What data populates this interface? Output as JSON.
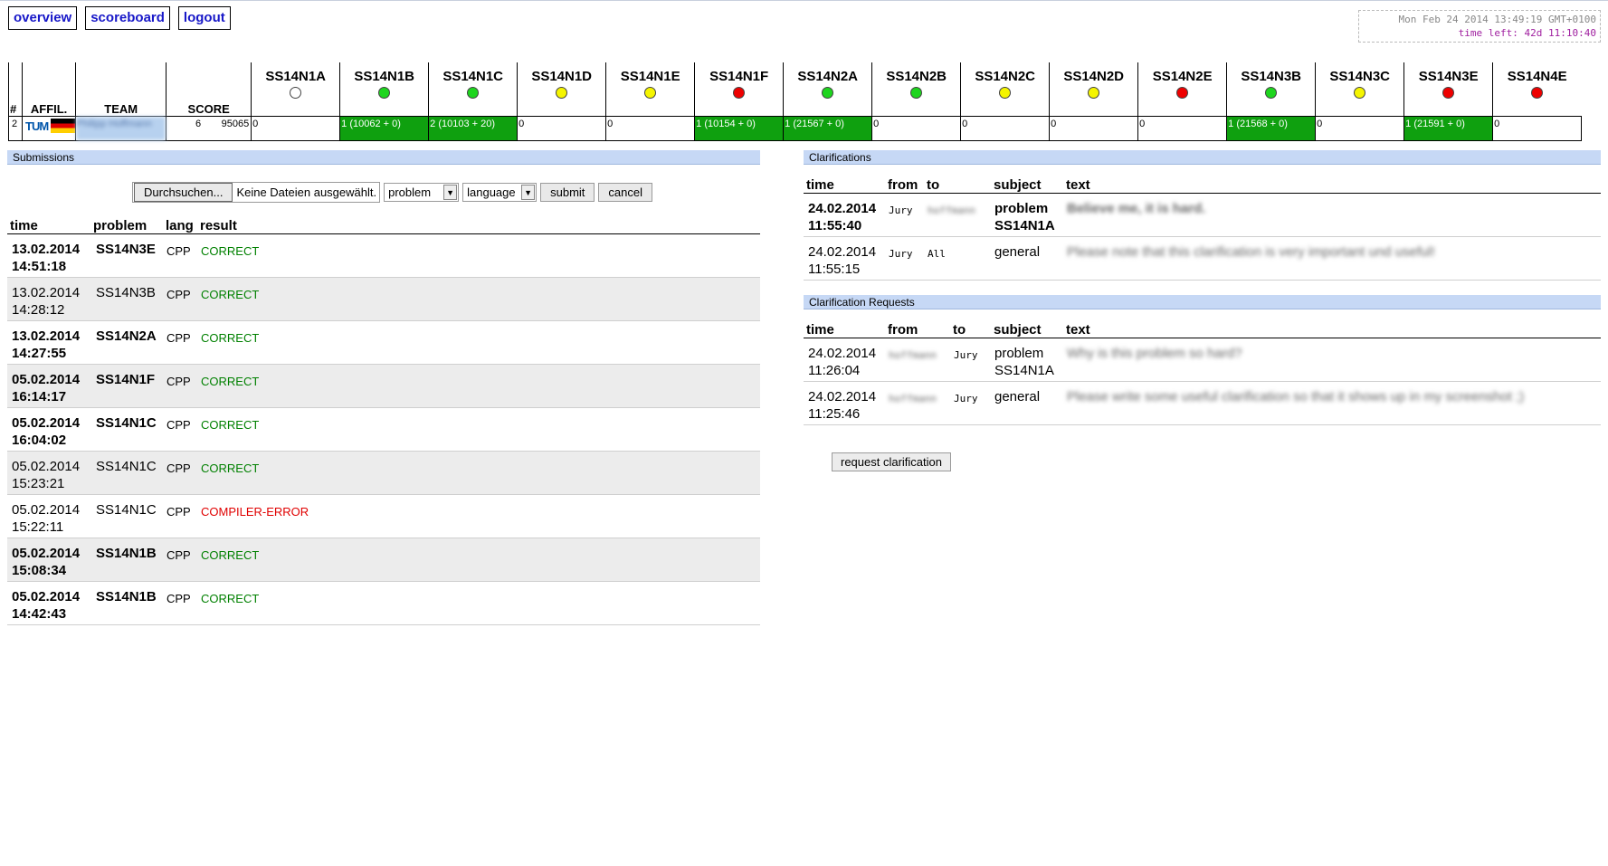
{
  "nav": {
    "overview": "overview",
    "scoreboard": "scoreboard",
    "logout": "logout"
  },
  "clock": {
    "time": "Mon Feb 24 2014 13:49:19 GMT+0100",
    "left": "time left: 42d 11:10:40"
  },
  "scoreboard": {
    "headers": {
      "rank": "#",
      "affil": "AFFIL.",
      "team": "TEAM",
      "score": "SCORE"
    },
    "problems": [
      {
        "name": "SS14N1A",
        "color": "#ffffff"
      },
      {
        "name": "SS14N1B",
        "color": "#1ed51e"
      },
      {
        "name": "SS14N1C",
        "color": "#1ed51e"
      },
      {
        "name": "SS14N1D",
        "color": "#f5f500"
      },
      {
        "name": "SS14N1E",
        "color": "#f5f500"
      },
      {
        "name": "SS14N1F",
        "color": "#ee0000"
      },
      {
        "name": "SS14N2A",
        "color": "#1ed51e"
      },
      {
        "name": "SS14N2B",
        "color": "#1ed51e"
      },
      {
        "name": "SS14N2C",
        "color": "#f5f500"
      },
      {
        "name": "SS14N2D",
        "color": "#f5f500"
      },
      {
        "name": "SS14N2E",
        "color": "#ee0000"
      },
      {
        "name": "SS14N3B",
        "color": "#1ed51e"
      },
      {
        "name": "SS14N3C",
        "color": "#f5f500"
      },
      {
        "name": "SS14N3E",
        "color": "#ee0000"
      },
      {
        "name": "SS14N4E",
        "color": "#ee0000"
      }
    ],
    "row": {
      "rank": "2",
      "affil": "TUM",
      "team": "Philipp Hoffmann",
      "solved": "6",
      "penalty": "95065",
      "cells": [
        {
          "text": "0",
          "solved": false
        },
        {
          "text": "1 (10062 + 0)",
          "solved": true
        },
        {
          "text": "2 (10103 + 20)",
          "solved": true
        },
        {
          "text": "0",
          "solved": false
        },
        {
          "text": "0",
          "solved": false
        },
        {
          "text": "1 (10154 + 0)",
          "solved": true
        },
        {
          "text": "1 (21567 + 0)",
          "solved": true
        },
        {
          "text": "0",
          "solved": false
        },
        {
          "text": "0",
          "solved": false
        },
        {
          "text": "0",
          "solved": false
        },
        {
          "text": "0",
          "solved": false
        },
        {
          "text": "1 (21568 + 0)",
          "solved": true
        },
        {
          "text": "0",
          "solved": false
        },
        {
          "text": "1 (21591 + 0)",
          "solved": true
        },
        {
          "text": "0",
          "solved": false
        }
      ]
    }
  },
  "submissions": {
    "heading": "Submissions",
    "form": {
      "browse": "Durchsuchen...",
      "nofile": "Keine Dateien ausgewählt.",
      "problem": "problem",
      "language": "language",
      "submit": "submit",
      "cancel": "cancel"
    },
    "columns": {
      "time": "time",
      "problem": "problem",
      "lang": "lang",
      "result": "result"
    },
    "rows": [
      {
        "date": "13.02.2014",
        "time": "14:51:18",
        "problem": "SS14N3E",
        "lang": "CPP",
        "result": "CORRECT",
        "bold": true,
        "alt": false
      },
      {
        "date": "13.02.2014",
        "time": "14:28:12",
        "problem": "SS14N3B",
        "lang": "CPP",
        "result": "CORRECT",
        "bold": false,
        "alt": true
      },
      {
        "date": "13.02.2014",
        "time": "14:27:55",
        "problem": "SS14N2A",
        "lang": "CPP",
        "result": "CORRECT",
        "bold": true,
        "alt": false
      },
      {
        "date": "05.02.2014",
        "time": "16:14:17",
        "problem": "SS14N1F",
        "lang": "CPP",
        "result": "CORRECT",
        "bold": true,
        "alt": true
      },
      {
        "date": "05.02.2014",
        "time": "16:04:02",
        "problem": "SS14N1C",
        "lang": "CPP",
        "result": "CORRECT",
        "bold": true,
        "alt": false
      },
      {
        "date": "05.02.2014",
        "time": "15:23:21",
        "problem": "SS14N1C",
        "lang": "CPP",
        "result": "CORRECT",
        "bold": false,
        "alt": true
      },
      {
        "date": "05.02.2014",
        "time": "15:22:11",
        "problem": "SS14N1C",
        "lang": "CPP",
        "result": "COMPILER-ERROR",
        "bold": false,
        "alt": false
      },
      {
        "date": "05.02.2014",
        "time": "15:08:34",
        "problem": "SS14N1B",
        "lang": "CPP",
        "result": "CORRECT",
        "bold": true,
        "alt": true
      },
      {
        "date": "05.02.2014",
        "time": "14:42:43",
        "problem": "SS14N1B",
        "lang": "CPP",
        "result": "CORRECT",
        "bold": true,
        "alt": false
      }
    ]
  },
  "clarifications": {
    "heading": "Clarifications",
    "columns": {
      "time": "time",
      "from": "from",
      "to": "to",
      "subject": "subject",
      "text": "text"
    },
    "rows": [
      {
        "date": "24.02.2014",
        "time": "11:55:40",
        "from": "Jury",
        "to": "hoffmann",
        "subject1": "problem",
        "subject2": "SS14N1A",
        "text": "Believe me, it is hard.",
        "bold": true
      },
      {
        "date": "24.02.2014",
        "time": "11:55:15",
        "from": "Jury",
        "to": "All",
        "subject1": "general",
        "subject2": "",
        "text": "Please note that this clarification is very important und useful!",
        "bold": false
      }
    ]
  },
  "requests": {
    "heading": "Clarification Requests",
    "columns": {
      "time": "time",
      "from": "from",
      "to": "to",
      "subject": "subject",
      "text": "text"
    },
    "rows": [
      {
        "date": "24.02.2014",
        "time": "11:26:04",
        "from": "hoffmann",
        "to": "Jury",
        "subject1": "problem",
        "subject2": "SS14N1A",
        "text": "Why is this problem so hard?"
      },
      {
        "date": "24.02.2014",
        "time": "11:25:46",
        "from": "hoffmann",
        "to": "Jury",
        "subject1": "general",
        "subject2": "",
        "text": "Please write some useful clarification so that it shows up in my screenshot ;)"
      }
    ],
    "button": "request clarification"
  }
}
